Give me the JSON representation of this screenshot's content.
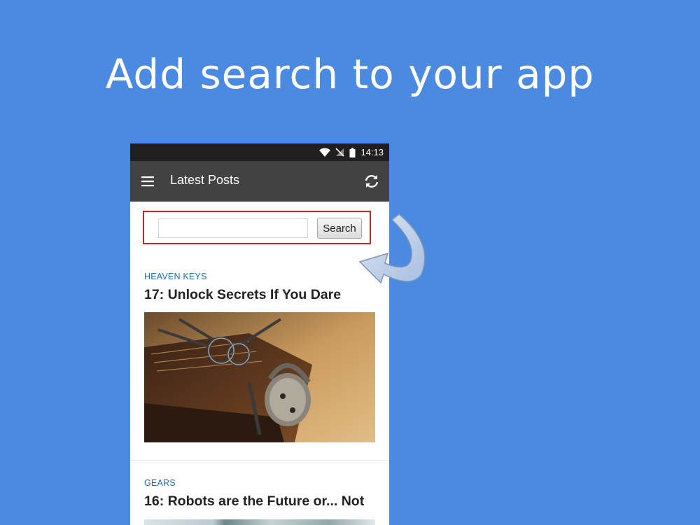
{
  "headline": "Add search to your app",
  "colors": {
    "background": "#4a8ae0",
    "app_bar": "#424242",
    "status_bar": "#1f1f1f",
    "highlight_border": "#c0282d",
    "category": "#1a6ea8"
  },
  "status_bar": {
    "time": "14:13",
    "icons": [
      "wifi-icon",
      "no-signal-icon",
      "battery-icon"
    ]
  },
  "app_bar": {
    "title": "Latest Posts",
    "menu_icon": "hamburger-menu-icon",
    "refresh_icon": "refresh-icon"
  },
  "search": {
    "input_value": "",
    "button_label": "Search"
  },
  "posts": [
    {
      "category": "HEAVEN KEYS",
      "title": "17: Unlock Secrets If You Dare"
    },
    {
      "category": "GEARS",
      "title": "16: Robots are the Future or... Not"
    }
  ]
}
